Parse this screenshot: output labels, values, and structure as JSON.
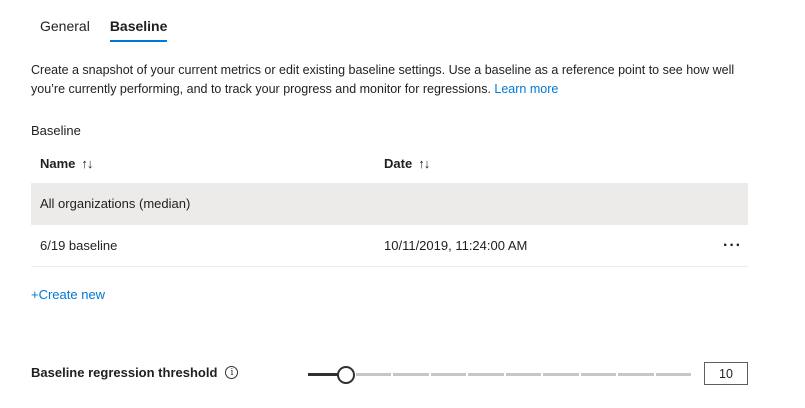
{
  "tabs": [
    {
      "label": "General",
      "active": false
    },
    {
      "label": "Baseline",
      "active": true
    }
  ],
  "description": {
    "text": "Create a snapshot of your current metrics or edit existing baseline settings. Use a baseline as a reference point to see how well you’re currently performing, and to track your progress and monitor for regressions. ",
    "link": "Learn more"
  },
  "baseline": {
    "section_label": "Baseline",
    "columns": [
      {
        "label": "Name",
        "sort_icon": "sort-arrows-icon"
      },
      {
        "label": "Date",
        "sort_icon": "sort-arrows-icon"
      }
    ],
    "rows": [
      {
        "name": "All organizations (median)",
        "date": "",
        "selected": true,
        "has_menu": false
      },
      {
        "name": "6/19 baseline",
        "date": "10/11/2019, 11:24:00 AM",
        "selected": false,
        "has_menu": true
      }
    ],
    "more_icon": "more-horizontal-icon",
    "create_new": "+Create new"
  },
  "threshold": {
    "label": "Baseline regression threshold",
    "info_icon": "info-icon",
    "value": "10",
    "slider_fraction": 0.1
  },
  "colors": {
    "accent": "#0078d4",
    "selected_row": "#edebe9",
    "text": "#201f1e"
  }
}
